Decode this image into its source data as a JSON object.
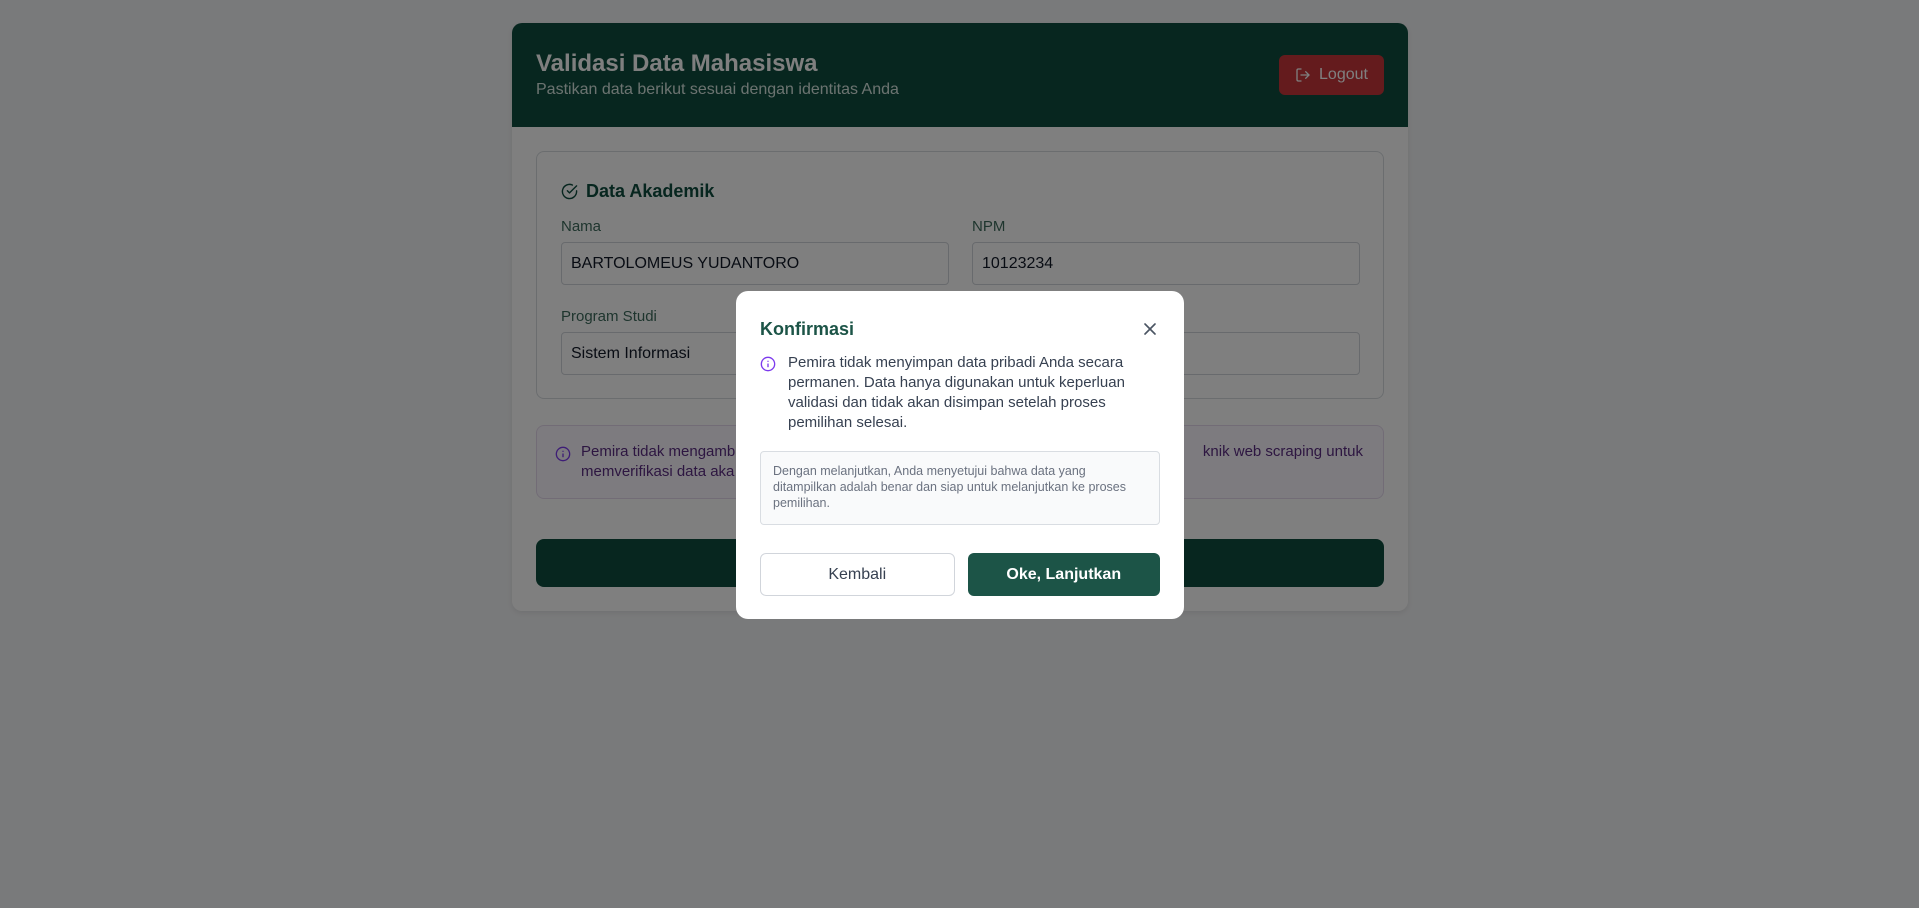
{
  "header": {
    "title": "Validasi Data Mahasiswa",
    "subtitle": "Pastikan data berikut sesuai dengan identitas Anda",
    "logout_label": "Logout"
  },
  "academic": {
    "title": "Data Akademik",
    "fields": [
      {
        "label": "Nama",
        "value": "BARTOLOMEUS YUDANTORO"
      },
      {
        "label": "NPM",
        "value": "10123234"
      },
      {
        "label": "Program Studi",
        "value": "Sistem Informasi"
      },
      {
        "label": "",
        "value": ""
      }
    ]
  },
  "info_notice": {
    "line1_left": "Pemira tidak mengamb",
    "line1_right": "knik web scraping untuk",
    "line2_left": "memverifikasi data aka"
  },
  "submit_label": "",
  "modal": {
    "title": "Konfirmasi",
    "body": "Pemira tidak menyimpan data pribadi Anda secara permanen. Data hanya digunakan untuk keperluan validasi dan tidak akan disimpan setelah proses pemilihan selesai.",
    "note": "Dengan melanjutkan, Anda menyetujui bahwa data yang ditampilkan adalah benar dan siap untuk melanjutkan ke proses pemilihan.",
    "cancel_label": "Kembali",
    "confirm_label": "Oke, Lanjutkan"
  },
  "colors": {
    "primary": "#0f4d3f",
    "danger": "#c8373a",
    "info_accent": "#7c3aed"
  }
}
